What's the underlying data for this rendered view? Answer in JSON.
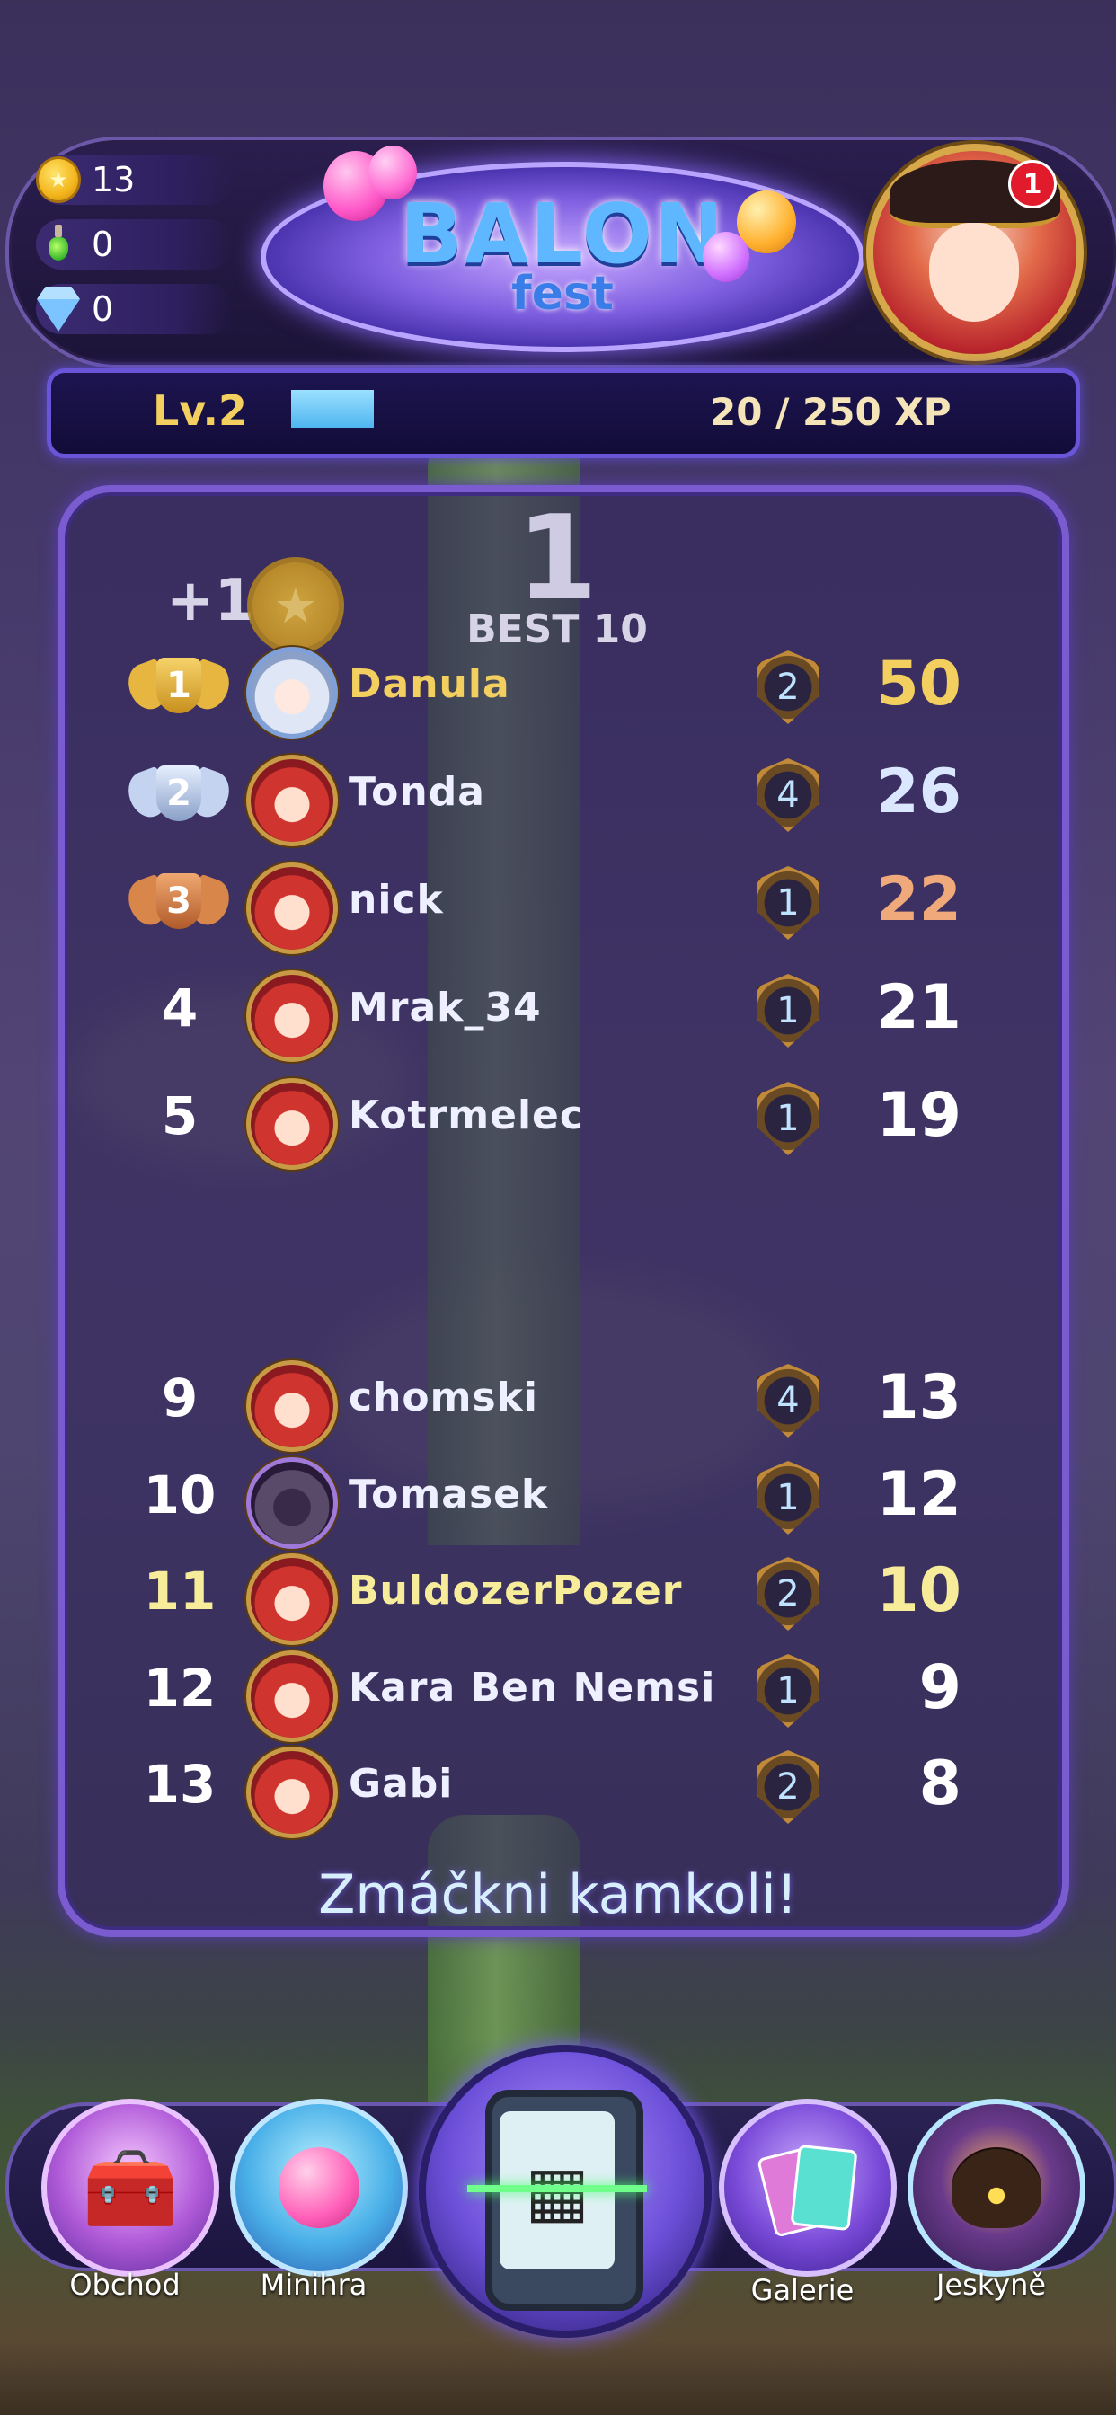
{
  "resources": {
    "coins": "13",
    "potions": "0",
    "gems": "0"
  },
  "logo": {
    "title": "BALON",
    "subtitle": "fest"
  },
  "profile": {
    "notification_count": "1"
  },
  "xp": {
    "level": "Lv.2",
    "progress_text": "20 / 250 XP",
    "progress_fraction": 0.08
  },
  "result": {
    "rank": "1",
    "best_label": "BEST 10",
    "reward": "+1"
  },
  "leaderboard": {
    "rows": [
      {
        "rank": "1",
        "name": "Danula",
        "level": "2",
        "score": "50",
        "medal": "gold",
        "avatar": "white-hair"
      },
      {
        "rank": "2",
        "name": "Tonda",
        "level": "4",
        "score": "26",
        "medal": "silver",
        "avatar": "red-hair"
      },
      {
        "rank": "3",
        "name": "nick",
        "level": "1",
        "score": "22",
        "medal": "bronze",
        "avatar": "red-hair"
      },
      {
        "rank": "4",
        "name": "Mrak_34",
        "level": "1",
        "score": "21",
        "avatar": "red-hair"
      },
      {
        "rank": "5",
        "name": "Kotrmelec",
        "level": "1",
        "score": "19",
        "avatar": "red-hair"
      },
      {
        "rank": "9",
        "name": "chomski",
        "level": "4",
        "score": "13",
        "avatar": "red-hair"
      },
      {
        "rank": "10",
        "name": "Tomasek",
        "level": "1",
        "score": "12",
        "avatar": "ninja"
      },
      {
        "rank": "11",
        "name": "BuldozerPozer",
        "level": "2",
        "score": "10",
        "avatar": "red-hair",
        "highlight": true
      },
      {
        "rank": "12",
        "name": "Kara Ben Nemsi",
        "level": "1",
        "score": "9",
        "avatar": "red-hair"
      },
      {
        "rank": "13",
        "name": "Gabi",
        "level": "2",
        "score": "8",
        "avatar": "red-hair"
      }
    ]
  },
  "prompt": "Zmáčkni kamkoli!",
  "nav": {
    "shop": "Obchod",
    "minigame": "Minihra",
    "gallery": "Galerie",
    "cave": "Jeskyně"
  },
  "colors": {
    "gold": "#f2cf5e",
    "silver": "#dbe6ff",
    "bronze": "#f0a97a",
    "highlight": "#f7ec9a",
    "accent": "#7a5cd0"
  }
}
